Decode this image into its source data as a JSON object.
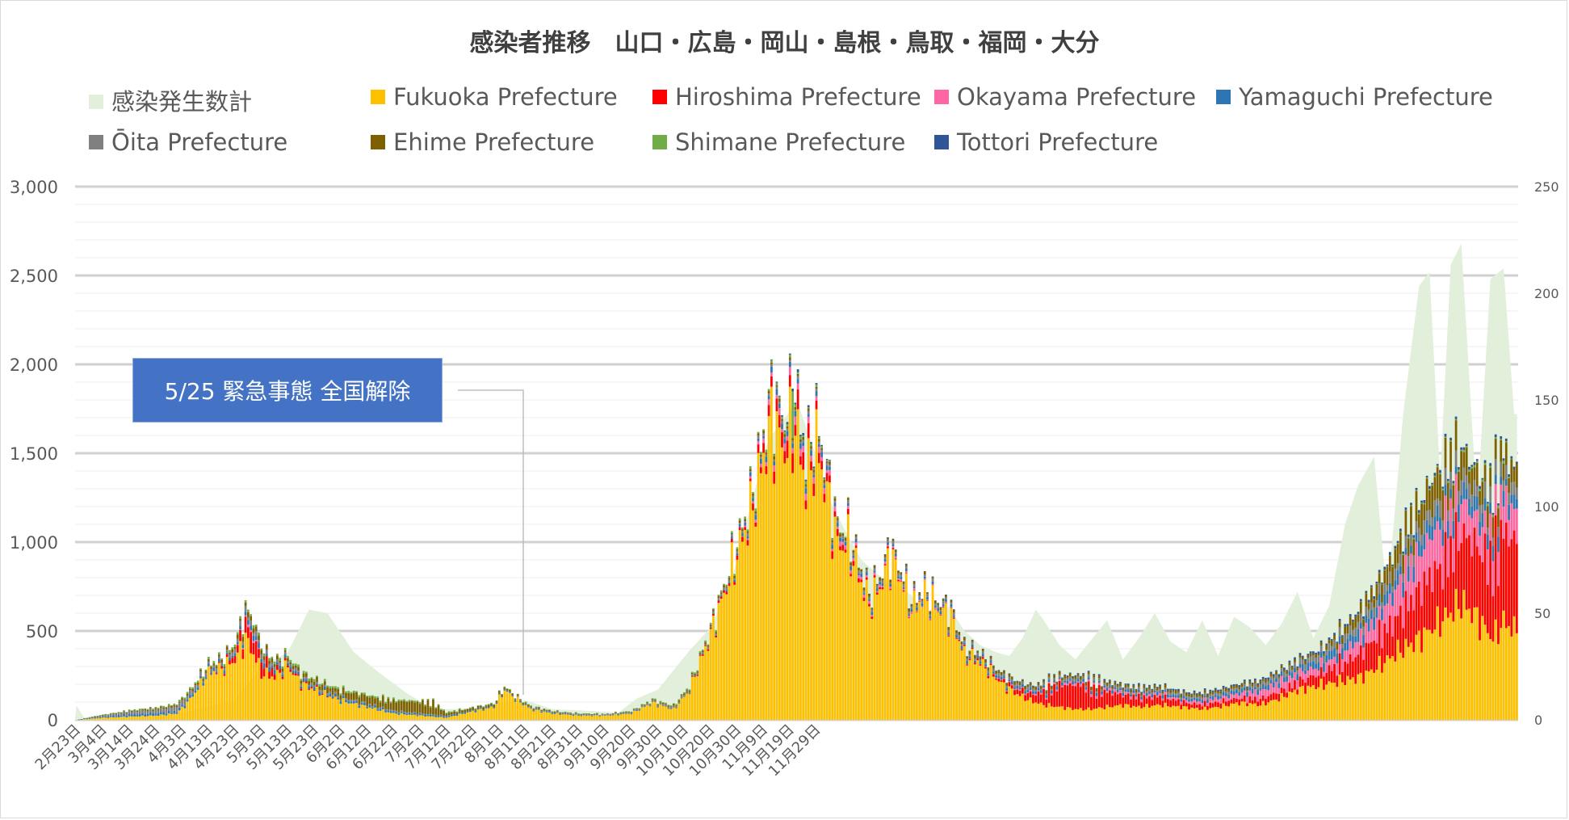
{
  "chart_data": {
    "type": "bar",
    "title": "感染者推移　山口・広島・岡山・島根・鳥取・福岡・大分",
    "left_axis": {
      "ticks": [
        "0",
        "500",
        "1,000",
        "1,500",
        "2,000",
        "2,500",
        "3,000"
      ],
      "min": 0,
      "max": 3000
    },
    "right_axis": {
      "ticks": [
        "0",
        "50",
        "100",
        "150",
        "200",
        "250"
      ],
      "min": 0,
      "max": 250
    },
    "x_tick_labels": [
      "2月23日",
      "3月4日",
      "3月14日",
      "3月24日",
      "4月3日",
      "4月13日",
      "4月23日",
      "5月3日",
      "5月13日",
      "5月23日",
      "6月2日",
      "6月12日",
      "6月22日",
      "7月2日",
      "7月12日",
      "7月22日",
      "8月1日",
      "8月11日",
      "8月21日",
      "8月31日",
      "9月10日",
      "9月20日",
      "9月30日",
      "10月10日",
      "10月20日",
      "10月30日",
      "11月9日",
      "11月19日",
      "11月29日"
    ],
    "grid": true,
    "legend_position": "top",
    "area_series": {
      "name": "感染発生数計",
      "color": "#e2efda",
      "axis": "left",
      "knots": [
        [
          0,
          80
        ],
        [
          3,
          10
        ],
        [
          20,
          20
        ],
        [
          40,
          40
        ],
        [
          60,
          110
        ],
        [
          70,
          300
        ],
        [
          80,
          380
        ],
        [
          88,
          620
        ],
        [
          95,
          600
        ],
        [
          105,
          380
        ],
        [
          115,
          260
        ],
        [
          125,
          150
        ],
        [
          135,
          60
        ],
        [
          150,
          60
        ],
        [
          160,
          90
        ],
        [
          170,
          110
        ],
        [
          180,
          60
        ],
        [
          195,
          50
        ],
        [
          205,
          40
        ],
        [
          212,
          120
        ],
        [
          220,
          170
        ],
        [
          232,
          390
        ],
        [
          240,
          520
        ],
        [
          248,
          790
        ],
        [
          255,
          1200
        ],
        [
          262,
          1580
        ],
        [
          268,
          1700
        ],
        [
          273,
          1780
        ],
        [
          280,
          1480
        ],
        [
          285,
          1240
        ],
        [
          291,
          1060
        ],
        [
          297,
          900
        ],
        [
          303,
          820
        ],
        [
          310,
          760
        ],
        [
          316,
          700
        ],
        [
          322,
          560
        ],
        [
          330,
          640
        ],
        [
          336,
          500
        ],
        [
          342,
          420
        ],
        [
          348,
          380
        ],
        [
          353,
          360
        ],
        [
          358,
          460
        ],
        [
          363,
          620
        ],
        [
          366,
          560
        ],
        [
          372,
          420
        ],
        [
          378,
          340
        ],
        [
          384,
          450
        ],
        [
          390,
          560
        ],
        [
          396,
          340
        ],
        [
          402,
          460
        ],
        [
          408,
          600
        ],
        [
          414,
          440
        ],
        [
          420,
          380
        ],
        [
          426,
          560
        ],
        [
          432,
          360
        ],
        [
          438,
          580
        ],
        [
          444,
          520
        ],
        [
          450,
          420
        ],
        [
          456,
          540
        ],
        [
          462,
          720
        ],
        [
          468,
          460
        ],
        [
          474,
          640
        ],
        [
          480,
          1100
        ],
        [
          485,
          1320
        ],
        [
          491,
          1480
        ],
        [
          496,
          680
        ],
        [
          502,
          1720
        ],
        [
          508,
          2440
        ],
        [
          512,
          2520
        ],
        [
          516,
          1360
        ],
        [
          520,
          2560
        ],
        [
          524,
          2680
        ],
        [
          530,
          1180
        ],
        [
          535,
          2480
        ],
        [
          540,
          2540
        ],
        [
          544,
          1720
        ]
      ]
    },
    "stacked_series": [
      {
        "name": "Fukuoka Prefecture",
        "color": "#ffc000"
      },
      {
        "name": "Hiroshima Prefecture",
        "color": "#ff0000"
      },
      {
        "name": "Okayama Prefecture",
        "color": "#ff66a3"
      },
      {
        "name": "Yamaguchi Prefecture",
        "color": "#2e75b6"
      },
      {
        "name": "Ōita Prefecture",
        "color": "#808080"
      },
      {
        "name": "Ehime Prefecture",
        "color": "#7f6000"
      },
      {
        "name": "Shimane Prefecture",
        "color": "#70ad47"
      },
      {
        "name": "Tottori Prefecture",
        "color": "#2f5597"
      }
    ],
    "stacked_axis": "right",
    "bar_peaks": {
      "fukuoka": [
        [
          0,
          0
        ],
        [
          10,
          1
        ],
        [
          30,
          2
        ],
        [
          38,
          3
        ],
        [
          42,
          8
        ],
        [
          45,
          13
        ],
        [
          50,
          22
        ],
        [
          55,
          24
        ],
        [
          60,
          28
        ],
        [
          64,
          38
        ],
        [
          67,
          31
        ],
        [
          70,
          22
        ],
        [
          75,
          20
        ],
        [
          80,
          25
        ],
        [
          85,
          17
        ],
        [
          92,
          13
        ],
        [
          100,
          9
        ],
        [
          110,
          6
        ],
        [
          120,
          3
        ],
        [
          130,
          2
        ],
        [
          140,
          1
        ],
        [
          150,
          4
        ],
        [
          158,
          6
        ],
        [
          162,
          14
        ],
        [
          166,
          10
        ],
        [
          172,
          5
        ],
        [
          180,
          3
        ],
        [
          190,
          2
        ],
        [
          200,
          2
        ],
        [
          210,
          3
        ],
        [
          218,
          8
        ],
        [
          226,
          5
        ],
        [
          232,
          14
        ],
        [
          240,
          40
        ],
        [
          248,
          70
        ],
        [
          256,
          100
        ],
        [
          263,
          140
        ],
        [
          268,
          126
        ],
        [
          272,
          138
        ],
        [
          276,
          110
        ],
        [
          280,
          128
        ],
        [
          284,
          106
        ],
        [
          288,
          82
        ],
        [
          292,
          82
        ],
        [
          296,
          68
        ],
        [
          300,
          54
        ],
        [
          304,
          62
        ],
        [
          308,
          76
        ],
        [
          312,
          66
        ],
        [
          316,
          52
        ],
        [
          321,
          58
        ],
        [
          326,
          52
        ],
        [
          331,
          48
        ],
        [
          336,
          30
        ],
        [
          341,
          28
        ],
        [
          346,
          22
        ],
        [
          351,
          16
        ],
        [
          356,
          12
        ],
        [
          361,
          9
        ],
        [
          366,
          7
        ],
        [
          372,
          6
        ],
        [
          378,
          5
        ],
        [
          384,
          5
        ],
        [
          390,
          6
        ],
        [
          396,
          7
        ],
        [
          402,
          6
        ],
        [
          410,
          7
        ],
        [
          418,
          6
        ],
        [
          426,
          5
        ],
        [
          432,
          6
        ],
        [
          440,
          8
        ],
        [
          448,
          7
        ],
        [
          455,
          10
        ],
        [
          462,
          14
        ],
        [
          470,
          16
        ],
        [
          478,
          18
        ],
        [
          486,
          20
        ],
        [
          494,
          26
        ],
        [
          500,
          32
        ],
        [
          506,
          36
        ],
        [
          512,
          42
        ],
        [
          518,
          48
        ],
        [
          524,
          55
        ],
        [
          530,
          48
        ],
        [
          536,
          38
        ],
        [
          540,
          46
        ],
        [
          544,
          42
        ]
      ],
      "hiroshima": [
        [
          0,
          0
        ],
        [
          50,
          0
        ],
        [
          57,
          1
        ],
        [
          62,
          4
        ],
        [
          67,
          8
        ],
        [
          72,
          4
        ],
        [
          78,
          1
        ],
        [
          100,
          0
        ],
        [
          230,
          0
        ],
        [
          245,
          1
        ],
        [
          255,
          2
        ],
        [
          265,
          5
        ],
        [
          272,
          7
        ],
        [
          280,
          4
        ],
        [
          290,
          2
        ],
        [
          300,
          1
        ],
        [
          320,
          0
        ],
        [
          350,
          1
        ],
        [
          362,
          3
        ],
        [
          372,
          9
        ],
        [
          380,
          10
        ],
        [
          388,
          7
        ],
        [
          396,
          4
        ],
        [
          405,
          4
        ],
        [
          420,
          2
        ],
        [
          440,
          2
        ],
        [
          460,
          3
        ],
        [
          472,
          5
        ],
        [
          486,
          10
        ],
        [
          496,
          14
        ],
        [
          506,
          18
        ],
        [
          515,
          24
        ],
        [
          524,
          28
        ],
        [
          532,
          30
        ],
        [
          540,
          38
        ],
        [
          544,
          36
        ]
      ],
      "okayama": [
        [
          0,
          0
        ],
        [
          60,
          0
        ],
        [
          66,
          1
        ],
        [
          70,
          0
        ],
        [
          250,
          0
        ],
        [
          262,
          2
        ],
        [
          272,
          3
        ],
        [
          282,
          2
        ],
        [
          300,
          1
        ],
        [
          340,
          0
        ],
        [
          380,
          1
        ],
        [
          420,
          1
        ],
        [
          440,
          2
        ],
        [
          455,
          4
        ],
        [
          470,
          3
        ],
        [
          486,
          6
        ],
        [
          500,
          12
        ],
        [
          512,
          18
        ],
        [
          522,
          14
        ],
        [
          532,
          12
        ],
        [
          540,
          14
        ],
        [
          544,
          12
        ]
      ],
      "yamaguchi": [
        [
          0,
          0
        ],
        [
          20,
          1
        ],
        [
          60,
          1
        ],
        [
          68,
          2
        ],
        [
          80,
          1
        ],
        [
          240,
          0
        ],
        [
          262,
          2
        ],
        [
          272,
          2
        ],
        [
          300,
          1
        ],
        [
          330,
          1
        ],
        [
          420,
          1
        ],
        [
          460,
          2
        ],
        [
          480,
          4
        ],
        [
          500,
          5
        ],
        [
          520,
          6
        ],
        [
          544,
          5
        ]
      ],
      "oita": [
        [
          0,
          0
        ],
        [
          40,
          2
        ],
        [
          55,
          1
        ],
        [
          64,
          2
        ],
        [
          80,
          1
        ],
        [
          150,
          0
        ],
        [
          262,
          1
        ],
        [
          290,
          1
        ],
        [
          340,
          1
        ],
        [
          440,
          1
        ],
        [
          480,
          3
        ],
        [
          500,
          4
        ],
        [
          520,
          6
        ],
        [
          544,
          5
        ]
      ],
      "ehime": [
        [
          0,
          0
        ],
        [
          58,
          1
        ],
        [
          66,
          2
        ],
        [
          80,
          1
        ],
        [
          135,
          5
        ],
        [
          140,
          1
        ],
        [
          200,
          0
        ],
        [
          262,
          1
        ],
        [
          280,
          1
        ],
        [
          330,
          1
        ],
        [
          470,
          1
        ],
        [
          490,
          5
        ],
        [
          506,
          10
        ],
        [
          518,
          12
        ],
        [
          530,
          8
        ],
        [
          544,
          8
        ]
      ],
      "shimane": [
        [
          0,
          0
        ],
        [
          64,
          1
        ],
        [
          70,
          1
        ],
        [
          200,
          0
        ],
        [
          262,
          1
        ],
        [
          276,
          1
        ],
        [
          300,
          0
        ],
        [
          480,
          0
        ],
        [
          540,
          1
        ],
        [
          544,
          0
        ]
      ],
      "tottori": [
        [
          0,
          0
        ],
        [
          262,
          0
        ],
        [
          272,
          1
        ],
        [
          290,
          0
        ],
        [
          500,
          1
        ],
        [
          544,
          1
        ]
      ]
    },
    "spike_annotations": [
      {
        "x_index": 271,
        "value": 22,
        "series": "Shimane Prefecture"
      }
    ]
  },
  "annotation": {
    "text": "5/25 緊急事態 全国解除"
  }
}
